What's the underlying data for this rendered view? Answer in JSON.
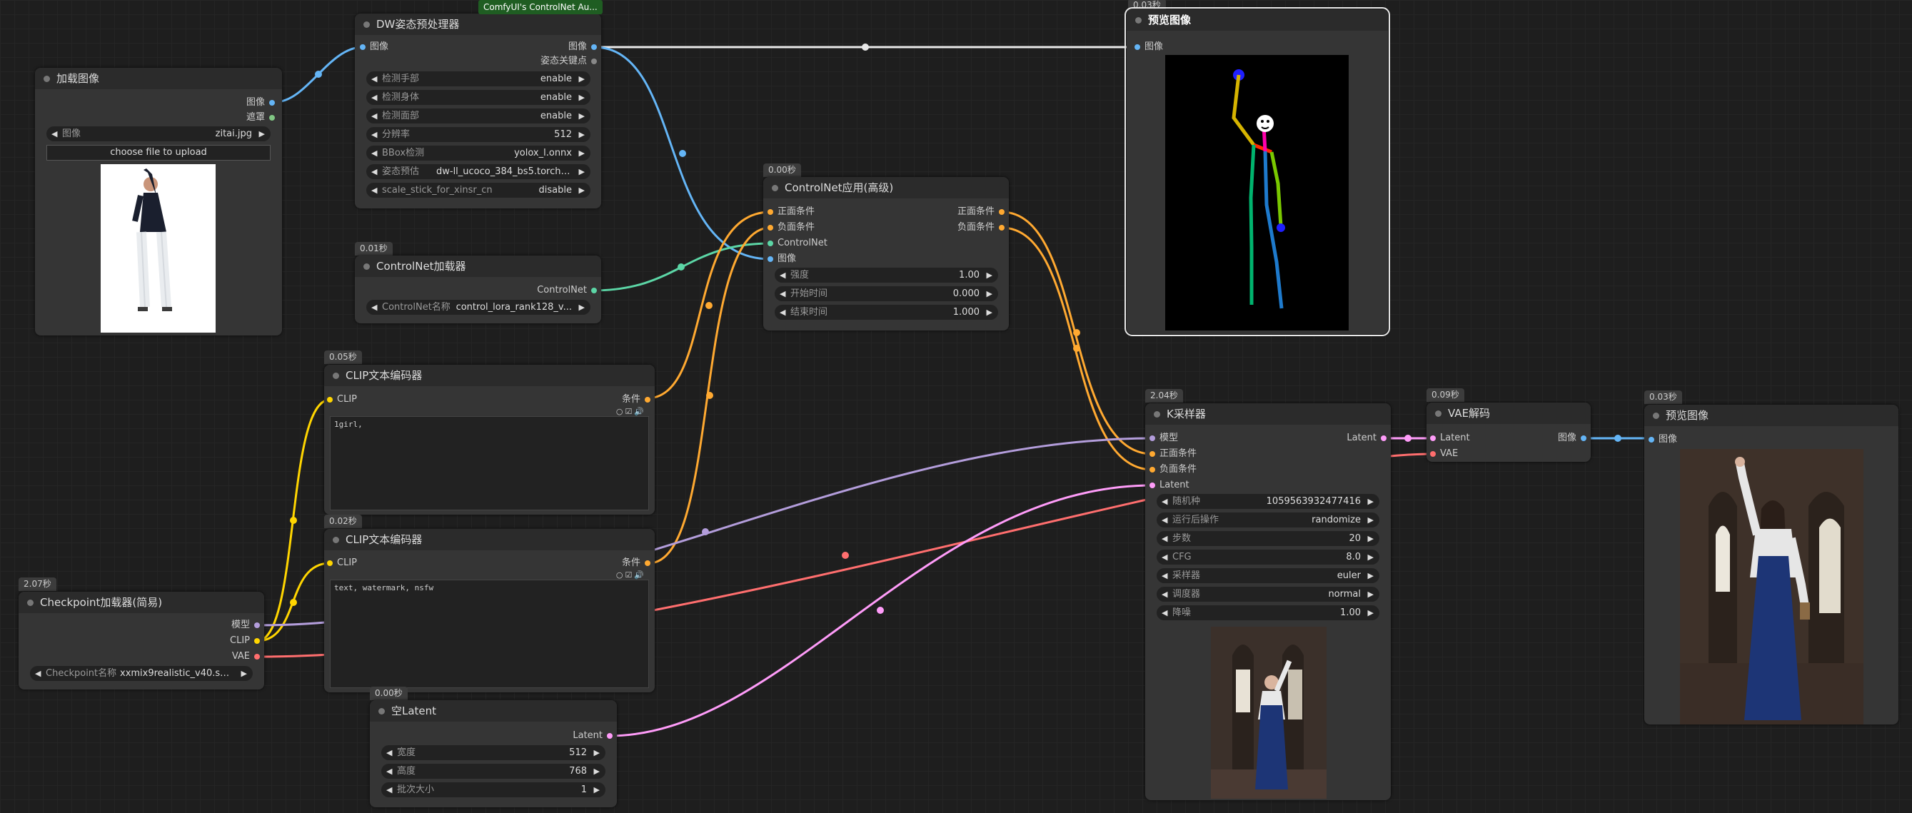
{
  "badge": "ComfyUI's ControlNet Au...",
  "colors": {
    "image": "#64b5f6",
    "mask": "#81c784",
    "conditioning": "#ffa931",
    "controlnet": "#00d78d",
    "clip": "#ffd500",
    "model": "#b39ddb",
    "vae": "#ff6e6e",
    "latent": "#ff9cf9"
  },
  "nodes": {
    "load_image": {
      "title": "加载图像",
      "out_image": "图像",
      "out_mask": "遮罩",
      "w_image_label": "图像",
      "w_image_value": "zitai.jpg",
      "upload_label": "choose file to upload"
    },
    "dwpose": {
      "title": "DW姿态预处理器",
      "in_image": "图像",
      "out_image": "图像",
      "out_keypoints": "姿态关键点",
      "widgets": [
        {
          "label": "检测手部",
          "value": "enable"
        },
        {
          "label": "检测身体",
          "value": "enable"
        },
        {
          "label": "检测面部",
          "value": "enable"
        },
        {
          "label": "分辨率",
          "value": "512"
        },
        {
          "label": "BBox检测",
          "value": "yolox_l.onnx"
        },
        {
          "label": "姿态预估",
          "value": "dw-ll_ucoco_384_bs5.torchscri..."
        },
        {
          "label": "scale_stick_for_xinsr_cn",
          "value": "disable"
        }
      ]
    },
    "preview_top": {
      "timing": "0.03秒",
      "title": "预览图像",
      "in_image": "图像"
    },
    "cn_loader": {
      "timing": "0.01秒",
      "title": "ControlNet加载器",
      "out_controlnet": "ControlNet",
      "w_label": "ControlNet名称",
      "w_value": "control_lora_rank128_v..."
    },
    "cn_apply": {
      "timing": "0.00秒",
      "title": "ControlNet应用(高级)",
      "in_pos": "正面条件",
      "in_neg": "负面条件",
      "in_cn": "ControlNet",
      "in_image": "图像",
      "out_pos": "正面条件",
      "out_neg": "负面条件",
      "widgets": [
        {
          "label": "强度",
          "value": "1.00"
        },
        {
          "label": "开始时间",
          "value": "0.000"
        },
        {
          "label": "结束时间",
          "value": "1.000"
        }
      ]
    },
    "clip_pos": {
      "timing": "0.05秒",
      "title": "CLIP文本编码器",
      "in_clip": "CLIP",
      "out_cond": "条件",
      "text": "1girl,"
    },
    "clip_neg": {
      "timing": "0.02秒",
      "title": "CLIP文本编码器",
      "in_clip": "CLIP",
      "out_cond": "条件",
      "text": "text, watermark, nsfw"
    },
    "checkpoint": {
      "timing": "2.07秒",
      "title": "Checkpoint加载器(简易)",
      "out_model": "模型",
      "out_clip": "CLIP",
      "out_vae": "VAE",
      "w_label": "Checkpoint名称",
      "w_value": "xxmix9realistic_v40.saf..."
    },
    "empty_latent": {
      "timing": "0.00秒",
      "title": "空Latent",
      "out_latent": "Latent",
      "widgets": [
        {
          "label": "宽度",
          "value": "512"
        },
        {
          "label": "高度",
          "value": "768"
        },
        {
          "label": "批次大小",
          "value": "1"
        }
      ]
    },
    "ksampler": {
      "timing": "2.04秒",
      "title": "K采样器",
      "in_model": "模型",
      "in_pos": "正面条件",
      "in_neg": "负面条件",
      "in_latent": "Latent",
      "out_latent": "Latent",
      "widgets": [
        {
          "label": "随机种",
          "value": "1059563932477416"
        },
        {
          "label": "运行后操作",
          "value": "randomize"
        },
        {
          "label": "步数",
          "value": "20"
        },
        {
          "label": "CFG",
          "value": "8.0"
        },
        {
          "label": "采样器",
          "value": "euler"
        },
        {
          "label": "调度器",
          "value": "normal"
        },
        {
          "label": "降噪",
          "value": "1.00"
        }
      ]
    },
    "vae_decode": {
      "timing": "0.09秒",
      "title": "VAE解码",
      "in_latent": "Latent",
      "in_vae": "VAE",
      "out_image": "图像"
    },
    "preview_right": {
      "timing": "0.03秒",
      "title": "预览图像",
      "in_image": "图像"
    }
  }
}
